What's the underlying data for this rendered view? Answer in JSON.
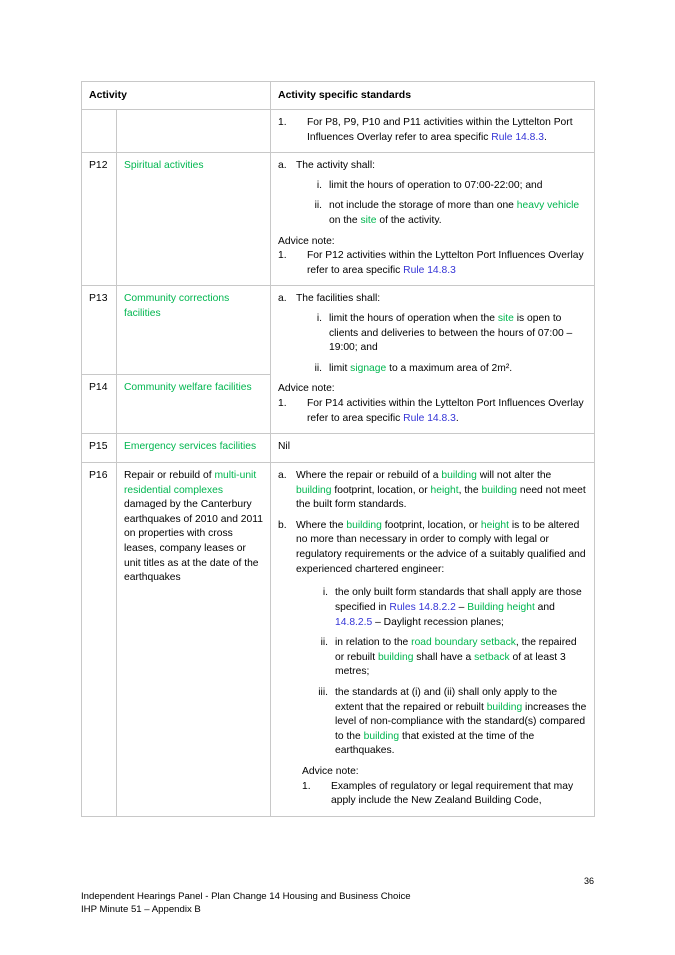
{
  "document": {
    "page_number": "36",
    "footer_line1": "Independent Hearings Panel - Plan Change 14 Housing and Business Choice",
    "footer_line2": "IHP Minute 51 – Appendix B"
  },
  "colors": {
    "green_term": "#00b64f",
    "blue_link": "#3434d6",
    "border": "#c8c8c8"
  },
  "table": {
    "headers": {
      "activity": "Activity",
      "standards": "Activity specific standards"
    },
    "rows": {
      "continued": {
        "code": "",
        "name": "",
        "item1_marker": "1.",
        "item1_text_a": "For P8, P9, P10 and P11 activities within the Lyttelton Port Influences Overlay refer to area specific ",
        "item1_link": "Rule 14.8.3",
        "item1_text_b": "."
      },
      "p12": {
        "code": "P12",
        "name": "Spiritual activities",
        "a_marker": "a.",
        "a_text": "The activity shall:",
        "i_marker": "i.",
        "i_text": "limit the hours of operation to 07:00-22:00; and",
        "ii_marker": "ii.",
        "ii_text_a": "not include the storage of more than one ",
        "ii_term1": "heavy vehicle",
        "ii_text_b": " on the ",
        "ii_term2": "site",
        "ii_text_c": " of the activity.",
        "advice_label": "Advice note:",
        "note_marker": "1.",
        "note_text_a": "For P12 activities within the Lyttelton Port Influences Overlay refer to area specific ",
        "note_link": "Rule 14.8.3"
      },
      "p13": {
        "code": "P13",
        "name": "Community corrections facilities"
      },
      "p14": {
        "code": "P14",
        "name": "Community welfare facilities",
        "a_marker": "a.",
        "a_text": "The facilities shall:",
        "i_marker": "i.",
        "i_text_a": "limit the hours of operation when the ",
        "i_term1": "site",
        "i_text_b": " is open to clients and deliveries to between the hours of 07:00 – 19:00; and",
        "ii_marker": "ii.",
        "ii_text_a": "limit ",
        "ii_term1": "signage",
        "ii_text_b": " to a maximum area of 2m².",
        "advice_label": "Advice note:",
        "note_marker": "1.",
        "note_text_a": "For P14 activities within the Lyttelton Port Influences Overlay refer to area specific ",
        "note_link": "Rule 14.8.3",
        "note_text_b": "."
      },
      "p15": {
        "code": "P15",
        "name": "Emergency services facilities",
        "standards": "Nil"
      },
      "p16": {
        "code": "P16",
        "name_text_a": "Repair or rebuild of ",
        "name_term": "multi-unit residential complexes",
        "name_text_b": " damaged by the Canterbury earthquakes of 2010 and 2011 on properties with cross leases, company leases or unit titles as at the date of the earthquakes",
        "a_marker": "a.",
        "a_text_1": "Where the repair or rebuild of a ",
        "a_term1": "building",
        "a_text_2": " will not alter the ",
        "a_term2": "building",
        "a_text_3": " footprint, location, or ",
        "a_term3": "height",
        "a_text_4": ", the ",
        "a_term4": "building",
        "a_text_5": " need not meet the built form standards.",
        "b_marker": "b.",
        "b_text_1": "Where the ",
        "b_term1": "building",
        "b_text_2": " footprint, location, or ",
        "b_term2": "height",
        "b_text_3": " is to be altered no more than necessary in order to comply with legal or regulatory requirements or the advice of a suitably qualified and experienced chartered engineer:",
        "i_marker": "i.",
        "i_text_1": "the only built form standards that shall apply are those specified in ",
        "i_link1": "Rules 14.8.2.2",
        "i_text_2": " – ",
        "i_term1": "Building height",
        "i_text_3": " and ",
        "i_link2": "14.8.2.5",
        "i_text_4": " – Daylight recession planes;",
        "ii_marker": "ii.",
        "ii_text_1": "in relation to the ",
        "ii_term1": "road boundary setback",
        "ii_text_2": ", the repaired or rebuilt ",
        "ii_term2": "building",
        "ii_text_3": " shall have a ",
        "ii_term3": "setback",
        "ii_text_4": " of at least 3 metres;",
        "iii_marker": "iii.",
        "iii_text_1": "the standards at (i) and (ii) shall only apply to the extent that the repaired or rebuilt ",
        "iii_term1": "building",
        "iii_text_2": " increases the level of non-compliance with the standard(s) compared to the ",
        "iii_term2": "building",
        "iii_text_3": " that existed at the time of the earthquakes.",
        "advice_label": "Advice note:",
        "note_marker": "1.",
        "note_text": "Examples of regulatory or legal requirement that may apply include the New Zealand Building Code,"
      }
    }
  }
}
